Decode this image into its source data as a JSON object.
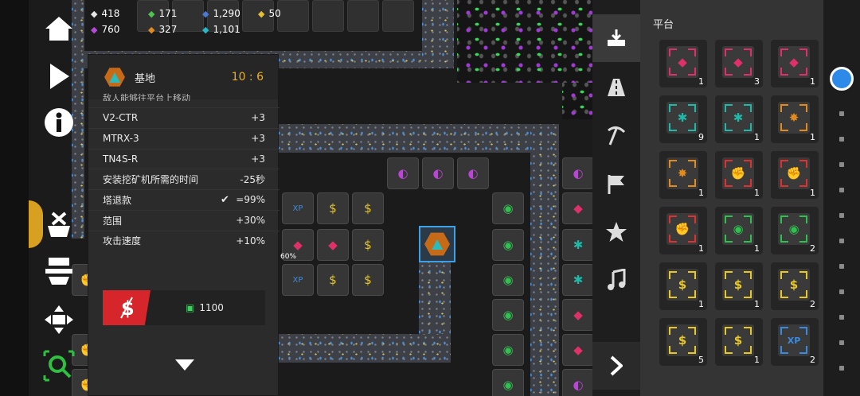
{
  "resources": [
    {
      "icon": "white-gem-icon",
      "value": "418",
      "color": "#e6e6e6"
    },
    {
      "icon": "green-gem-icon",
      "value": "171",
      "color": "#4fc34f"
    },
    {
      "icon": "blue-triangle-icon",
      "value": "1,290",
      "color": "#4a78d8"
    },
    {
      "icon": "yellow-pentagon-icon",
      "value": "50",
      "color": "#e2c030"
    },
    {
      "icon": "purple-gem-icon",
      "value": "760",
      "color": "#b44ad8"
    },
    {
      "icon": "orange-gem-icon",
      "value": "327",
      "color": "#e08a20"
    },
    {
      "icon": "teal-crystal-icon",
      "value": "1,101",
      "color": "#28b8c8"
    }
  ],
  "panel": {
    "title": "基地",
    "level": "10 : 6",
    "subtitle": "敌人能够往平台上移动",
    "rows": [
      {
        "label": "V2-CTR",
        "value": "+3"
      },
      {
        "label": "MTRX-3",
        "value": "+3"
      },
      {
        "label": "TN4S-R",
        "value": "+3"
      },
      {
        "label": "安装挖矿机所需的时间",
        "value": "-25秒"
      },
      {
        "label": "塔退款",
        "value": "=99%"
      },
      {
        "label": "范围",
        "value": "+30%"
      },
      {
        "label": "攻击速度",
        "value": "+10%"
      }
    ],
    "sell_price": "1100"
  },
  "map_label": "60%",
  "platform": {
    "title": "平台",
    "items": [
      {
        "glyph": "◆",
        "color": "#e0306a",
        "count": "1"
      },
      {
        "glyph": "◆",
        "color": "#e0306a",
        "count": "3"
      },
      {
        "glyph": "◆",
        "color": "#e0306a",
        "count": "1"
      },
      {
        "glyph": "✱",
        "color": "#20b8a8",
        "count": "9"
      },
      {
        "glyph": "✱",
        "color": "#20b8a8",
        "count": "1"
      },
      {
        "glyph": "✸",
        "color": "#e08a20",
        "count": "1"
      },
      {
        "glyph": "✸",
        "color": "#e08a20",
        "count": "1"
      },
      {
        "glyph": "✊",
        "color": "#e03030",
        "count": "1"
      },
      {
        "glyph": "✊",
        "color": "#e03030",
        "count": "1"
      },
      {
        "glyph": "✊",
        "color": "#e03030",
        "count": "1"
      },
      {
        "glyph": "◉",
        "color": "#30c050",
        "count": "1"
      },
      {
        "glyph": "◉",
        "color": "#30c050",
        "count": "2"
      },
      {
        "glyph": "$",
        "color": "#e8c828",
        "count": "1"
      },
      {
        "glyph": "$",
        "color": "#e8c828",
        "count": "1"
      },
      {
        "glyph": "$",
        "color": "#e8c828",
        "count": "2"
      },
      {
        "glyph": "$",
        "color": "#e8c828",
        "count": "5"
      },
      {
        "glyph": "$",
        "color": "#e8c828",
        "count": "1"
      },
      {
        "glyph": "XP",
        "color": "#3a8ae0",
        "count": "2"
      }
    ]
  }
}
